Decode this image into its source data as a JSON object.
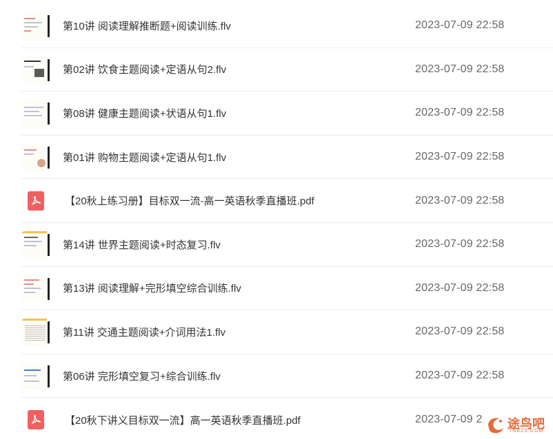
{
  "files": [
    {
      "name": "第10讲 阅读理解推断题+阅读训练.flv",
      "date": "2023-07-09 22:58",
      "type": "video"
    },
    {
      "name": "第02讲 饮食主题阅读+定语从句2.flv",
      "date": "2023-07-09 22:58",
      "type": "video"
    },
    {
      "name": "第08讲 健康主题阅读+状语从句1.flv",
      "date": "2023-07-09 22:58",
      "type": "video"
    },
    {
      "name": "第01讲 购物主题阅读+定语从句1.flv",
      "date": "2023-07-09 22:58",
      "type": "video"
    },
    {
      "name": "【20秋上练习册】目标双一流-高一英语秋季直播班.pdf",
      "date": "2023-07-09 22:58",
      "type": "pdf"
    },
    {
      "name": "第14讲 世界主题阅读+时态复习.flv",
      "date": "2023-07-09 22:58",
      "type": "video"
    },
    {
      "name": "第13讲 阅读理解+完形填空综合训练.flv",
      "date": "2023-07-09 22:58",
      "type": "video"
    },
    {
      "name": "第11讲 交通主题阅读+介词用法1.flv",
      "date": "2023-07-09 22:58",
      "type": "video"
    },
    {
      "name": "第06讲 完形填空复习+综合训练.flv",
      "date": "2023-07-09 22:58",
      "type": "video"
    },
    {
      "name": "【20秋下讲义目标双一流】高一英语秋季直播班.pdf",
      "date": "2023-07-09 2",
      "type": "pdf"
    }
  ],
  "watermark": {
    "text": "途鸟吧",
    "sub": "TNBZS.COM"
  },
  "colors": {
    "pdf_icon": "#f06060",
    "accent": "#e86a3c",
    "divider": "#ececec"
  }
}
